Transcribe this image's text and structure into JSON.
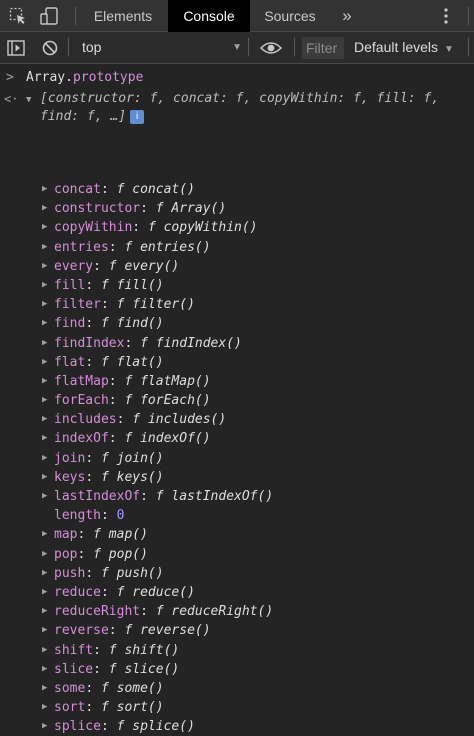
{
  "toolbar": {
    "tabs": [
      {
        "label": "Elements"
      },
      {
        "label": "Console"
      },
      {
        "label": "Sources"
      }
    ],
    "more_label": "»",
    "context_value": "top",
    "filter_placeholder": "Filter",
    "levels_label": "Default levels"
  },
  "console": {
    "input_prompt": ">",
    "input_object": "Array.",
    "input_property": "prototype",
    "output_prompt": "<·",
    "summary_line1": "[constructor: f, concat: f, copyWithin: f, fill: f,",
    "summary_line2": "find: f, …]",
    "info_badge": "i",
    "properties": [
      {
        "name": "concat",
        "sig": "concat()"
      },
      {
        "name": "constructor",
        "sig": "Array()"
      },
      {
        "name": "copyWithin",
        "sig": "copyWithin()"
      },
      {
        "name": "entries",
        "sig": "entries()"
      },
      {
        "name": "every",
        "sig": "every()"
      },
      {
        "name": "fill",
        "sig": "fill()"
      },
      {
        "name": "filter",
        "sig": "filter()"
      },
      {
        "name": "find",
        "sig": "find()"
      },
      {
        "name": "findIndex",
        "sig": "findIndex()"
      },
      {
        "name": "flat",
        "sig": "flat()"
      },
      {
        "name": "flatMap",
        "sig": "flatMap()"
      },
      {
        "name": "forEach",
        "sig": "forEach()"
      },
      {
        "name": "includes",
        "sig": "includes()"
      },
      {
        "name": "indexOf",
        "sig": "indexOf()"
      },
      {
        "name": "join",
        "sig": "join()"
      },
      {
        "name": "keys",
        "sig": "keys()"
      },
      {
        "name": "lastIndexOf",
        "sig": "lastIndexOf()"
      },
      {
        "name": "length",
        "value": "0"
      },
      {
        "name": "map",
        "sig": "map()"
      },
      {
        "name": "pop",
        "sig": "pop()"
      },
      {
        "name": "push",
        "sig": "push()"
      },
      {
        "name": "reduce",
        "sig": "reduce()"
      },
      {
        "name": "reduceRight",
        "sig": "reduceRight()"
      },
      {
        "name": "reverse",
        "sig": "reverse()"
      },
      {
        "name": "shift",
        "sig": "shift()"
      },
      {
        "name": "slice",
        "sig": "slice()"
      },
      {
        "name": "some",
        "sig": "some()"
      },
      {
        "name": "sort",
        "sig": "sort()"
      },
      {
        "name": "splice",
        "sig": "splice()"
      }
    ],
    "function_glyph": "f"
  },
  "colors": {
    "property_name": "#d58cd9",
    "number_value": "#9b9dfa",
    "active_tab_bg": "#000000",
    "info_badge": "#5e8dd0"
  },
  "icons": [
    "inspect-cursor-icon",
    "device-toggle-icon",
    "more-tabs-icon",
    "kebab-menu-icon",
    "sidebar-toggle-icon",
    "clear-console-icon",
    "dropdown-caret-icon",
    "eye-icon",
    "expand-triangle-icon",
    "collapse-triangle-icon"
  ]
}
